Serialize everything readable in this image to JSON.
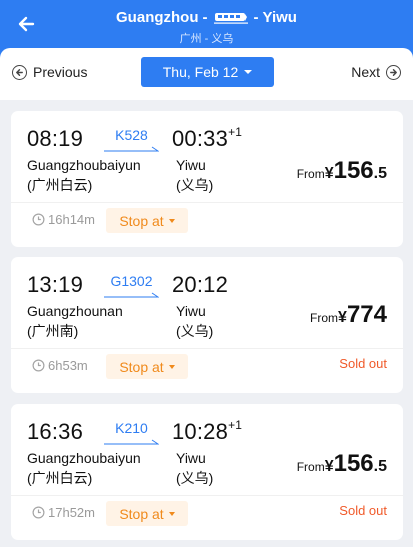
{
  "header": {
    "from_city": "Guangzhou",
    "to_city": "Yiwu",
    "separator": "-",
    "subtitle": "广州 - 义乌",
    "bg_color": "#2e7df2",
    "back_icon": "arrow-left-icon",
    "mode_icon": "train-icon"
  },
  "datebar": {
    "prev_label": "Previous",
    "next_label": "Next",
    "date_label": "Thu, Feb 12"
  },
  "trains": [
    {
      "dep_time": "08:19",
      "train_no": "K528",
      "arr_time": "00:33",
      "arr_day_offset": "+1",
      "from_station": "Guangzhoubaiyun",
      "from_station_cn": "(广州白云)",
      "to_station": "Yiwu",
      "to_station_cn": "(义乌)",
      "price_prefix": "From",
      "currency": "¥",
      "price_int": "156",
      "price_dec": ".5",
      "duration": "16h14m",
      "stop_label": "Stop at",
      "status": ""
    },
    {
      "dep_time": "13:19",
      "train_no": "G1302",
      "arr_time": "20:12",
      "arr_day_offset": "",
      "from_station": "Guangzhounan",
      "from_station_cn": "(广州南)",
      "to_station": "Yiwu",
      "to_station_cn": "(义乌)",
      "price_prefix": "From",
      "currency": "¥",
      "price_int": "774",
      "price_dec": "",
      "duration": "6h53m",
      "stop_label": "Stop at",
      "status": "Sold out"
    },
    {
      "dep_time": "16:36",
      "train_no": "K210",
      "arr_time": "10:28",
      "arr_day_offset": "+1",
      "from_station": "Guangzhoubaiyun",
      "from_station_cn": "(广州白云)",
      "to_station": "Yiwu",
      "to_station_cn": "(义乌)",
      "price_prefix": "From",
      "currency": "¥",
      "price_int": "156",
      "price_dec": ".5",
      "duration": "17h52m",
      "stop_label": "Stop at",
      "status": "Sold out"
    }
  ],
  "colors": {
    "accent": "#2e7df2",
    "stop_text": "#f08a1c",
    "stop_bg": "#fff3e6",
    "sold_out": "#f05a2a",
    "page_bg": "#eef0f4"
  }
}
